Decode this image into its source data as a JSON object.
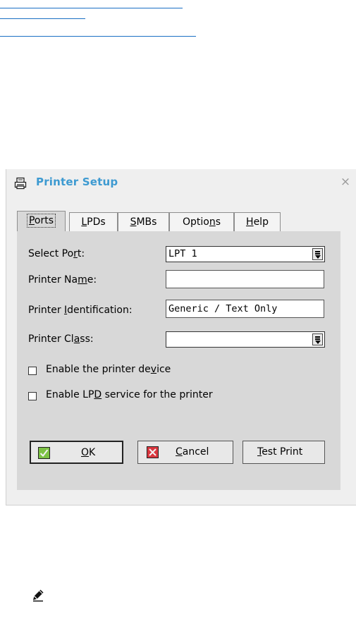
{
  "dialog": {
    "title": "Printer Setup",
    "close_glyph": "×",
    "icons": {
      "window": "printer-icon",
      "close": "close-icon"
    }
  },
  "tabs": [
    {
      "pre": "",
      "key": "P",
      "post": "orts",
      "active": true
    },
    {
      "pre": "",
      "key": "L",
      "post": "PDs",
      "active": false
    },
    {
      "pre": "",
      "key": "S",
      "post": "MBs",
      "active": false
    },
    {
      "pre": "Optio",
      "key": "n",
      "post": "s",
      "active": false
    },
    {
      "pre": "",
      "key": "H",
      "post": "elp",
      "active": false
    }
  ],
  "form": {
    "select_port": {
      "label_pre": "Select Po",
      "label_key": "r",
      "label_post": "t:",
      "value": "LPT 1"
    },
    "printer_name": {
      "label_pre": "Printer Na",
      "label_key": "m",
      "label_post": "e:",
      "value": ""
    },
    "printer_identification": {
      "label_pre": "Printer ",
      "label_key": "I",
      "label_post": "dentification:",
      "value": "Generic / Text Only"
    },
    "printer_class": {
      "label_pre": "Printer Cl",
      "label_key": "a",
      "label_post": "ss:",
      "value": ""
    }
  },
  "checkboxes": [
    {
      "pre": "Enable the printer de",
      "key": "v",
      "post": "ice",
      "checked": false
    },
    {
      "pre": "Enable LP",
      "key": "D",
      "post": " service for the printer",
      "checked": false
    }
  ],
  "buttons": {
    "ok": {
      "pre": "",
      "key": "O",
      "post": "K",
      "icon": "check-icon"
    },
    "cancel": {
      "pre": "",
      "key": "C",
      "post": "ancel",
      "icon": "x-icon"
    },
    "test_print": {
      "pre": "",
      "key": "T",
      "post": "est Print"
    }
  },
  "colors": {
    "title": "#3d9ad1",
    "link": "#1a6fc4",
    "ok_icon": "#7cc144",
    "cancel_icon": "#d9363e"
  },
  "note_icon": "pencil-note-icon"
}
